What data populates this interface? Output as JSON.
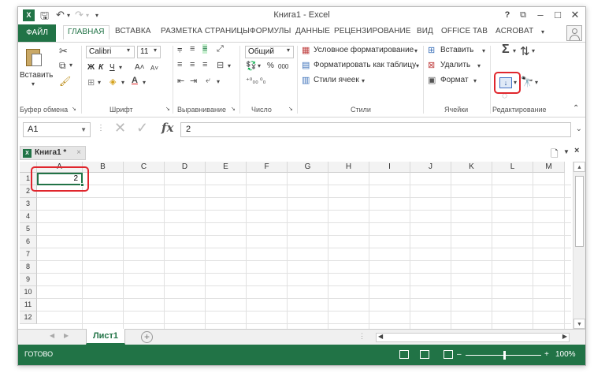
{
  "titlebar": {
    "app_icon": "X",
    "title": "Книга1 - Excel",
    "help": "?",
    "minimize": "–",
    "maximize": "□",
    "close": "✕"
  },
  "ribbon_tabs": {
    "file": "ФАЙЛ",
    "home": "ГЛАВНАЯ",
    "insert": "ВСТАВКА",
    "page_layout": "РАЗМЕТКА СТРАНИЦЫ",
    "formulas": "ФОРМУЛЫ",
    "data": "ДАННЫЕ",
    "review": "РЕЦЕНЗИРОВАНИЕ",
    "view": "ВИД",
    "office_tab": "OFFICE TAB",
    "acrobat": "ACROBAT"
  },
  "ribbon": {
    "clipboard": {
      "paste": "Вставить",
      "label": "Буфер обмена"
    },
    "font": {
      "name": "Calibri",
      "size": "11",
      "bold": "Ж",
      "italic": "К",
      "underline": "Ч",
      "grow": "A˄",
      "shrink": "A˅",
      "label": "Шрифт"
    },
    "alignment": {
      "label": "Выравнивание"
    },
    "number": {
      "format": "Общий",
      "percent": "%",
      "thousands": "000",
      "label": "Число"
    },
    "styles": {
      "conditional": "Условное форматирование",
      "as_table": "Форматировать как таблицу",
      "cell_styles": "Стили ячеек",
      "label": "Стили"
    },
    "cells": {
      "insert": "Вставить",
      "delete": "Удалить",
      "format": "Формат",
      "label": "Ячейки"
    },
    "editing": {
      "sum": "Σ",
      "fill": "↓",
      "label": "Редактирование"
    }
  },
  "formula_bar": {
    "name_box": "A1",
    "cancel": "✕",
    "enter": "✓",
    "fx": "fx",
    "value": "2"
  },
  "workbook_tab": {
    "name": "Книга1 *",
    "close": "×"
  },
  "grid": {
    "columns": [
      "A",
      "B",
      "C",
      "D",
      "E",
      "F",
      "G",
      "H",
      "I",
      "J",
      "K",
      "L",
      "M"
    ],
    "rows": [
      "1",
      "2",
      "3",
      "4",
      "5",
      "6",
      "7",
      "8",
      "9",
      "10",
      "11",
      "12"
    ],
    "a1_value": "2"
  },
  "sheets": {
    "active": "Лист1",
    "add": "+"
  },
  "status": {
    "ready": "ГОТОВО",
    "zoom": "100%",
    "minus": "–",
    "plus": "+"
  },
  "colors": {
    "accent": "#217346",
    "highlight": "#e0262d"
  }
}
